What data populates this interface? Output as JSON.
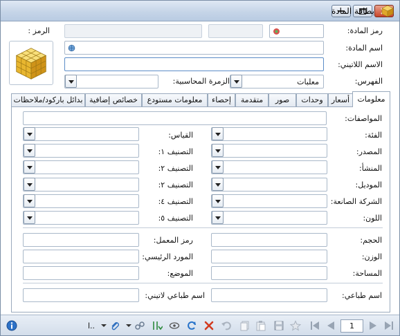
{
  "window": {
    "title": "بطاقة المادة"
  },
  "form": {
    "code_label": "رمز المادة:",
    "symbol_label": "الرمز :",
    "name_label": "اسم المادة:",
    "latin_name_label": "الاسم اللاتيني:",
    "index_label": "الفهرس:",
    "index_value": "معلبات",
    "accounting_group_label": "الزمرة المحاسبية:"
  },
  "tabs": [
    {
      "label": "معلومات",
      "active": true
    },
    {
      "label": "أسعار"
    },
    {
      "label": "وحدات"
    },
    {
      "label": "صور"
    },
    {
      "label": "متقدمة"
    },
    {
      "label": "إحصاء"
    },
    {
      "label": "معلومات مستودع"
    },
    {
      "label": "خصائص إضافية"
    },
    {
      "label": "بدائل باركود/ملاحظات"
    }
  ],
  "info": {
    "specs_label": "المواصفات:",
    "category_label": "الفئة:",
    "size_label": "القياس:",
    "source_label": "المصدر:",
    "class1_label": "التصنيف ١:",
    "origin_label": "المنشأ:",
    "class2a_label": "التصنيف ٢:",
    "model_label": "الموديل:",
    "class2b_label": "التصنيف ٢:",
    "manufacturer_label": "الشركة الصانعة:",
    "class4_label": "التصنيف ٤:",
    "color_label": "اللون:",
    "class5_label": "التصنيف ٥:",
    "volume_label": "الحجم:",
    "factory_code_label": "رمز المعمل:",
    "weight_label": "الوزن:",
    "main_supplier_label": "المورد الرئيسي:",
    "area_label": "المساحة:",
    "location_label": "الموضع:",
    "print_name_label": "اسم طباعي:",
    "latin_print_name_label": "اسم طباعي لاتيني:"
  },
  "toolbar": {
    "page_number": "1",
    "extra_label": "ا.."
  },
  "icons": {
    "app": "box-icon",
    "cube": "yellow-cube-icon"
  },
  "colors": {
    "titlebar": "#c6d5e8",
    "close": "#c9452a",
    "border": "#9aaabd"
  }
}
